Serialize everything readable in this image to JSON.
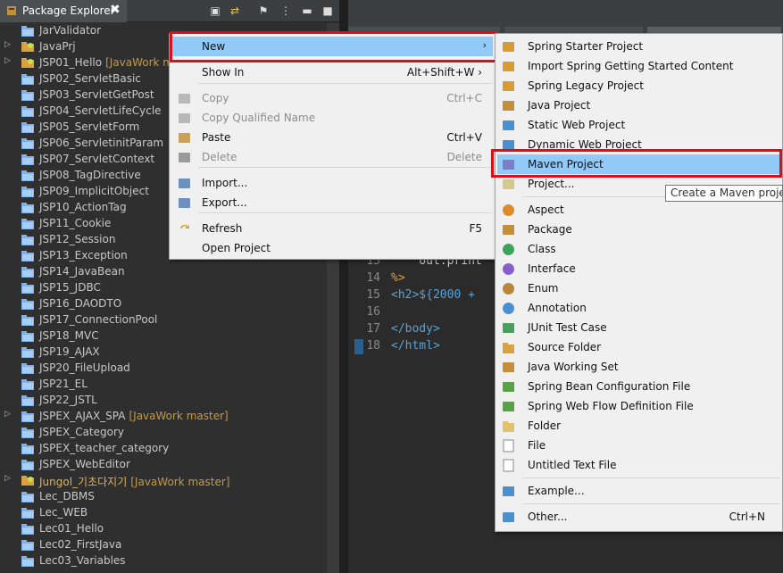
{
  "package_explorer": {
    "tab_label": "Package Explorer",
    "close_label": "✖",
    "items": [
      {
        "name": "JarValidator",
        "expandable": false,
        "branch": "",
        "special": false
      },
      {
        "name": "JavaPrj",
        "expandable": true,
        "branch": "",
        "special": false
      },
      {
        "name": "JSP01_Hello",
        "expandable": true,
        "branch": "[JavaWork master]",
        "special": false
      },
      {
        "name": "JSP02_ServletBasic",
        "expandable": false,
        "branch": "",
        "special": false
      },
      {
        "name": "JSP03_ServletGetPost",
        "expandable": false,
        "branch": "",
        "special": false
      },
      {
        "name": "JSP04_ServletLifeCycle",
        "expandable": false,
        "branch": "",
        "special": false
      },
      {
        "name": "JSP05_ServletForm",
        "expandable": false,
        "branch": "",
        "special": false
      },
      {
        "name": "JSP06_ServletinitParam",
        "expandable": false,
        "branch": "",
        "special": false
      },
      {
        "name": "JSP07_ServletContext",
        "expandable": false,
        "branch": "",
        "special": false
      },
      {
        "name": "JSP08_TagDirective",
        "expandable": false,
        "branch": "",
        "special": false
      },
      {
        "name": "JSP09_ImplicitObject",
        "expandable": false,
        "branch": "",
        "special": false
      },
      {
        "name": "JSP10_ActionTag",
        "expandable": false,
        "branch": "",
        "special": false
      },
      {
        "name": "JSP11_Cookie",
        "expandable": false,
        "branch": "",
        "special": false
      },
      {
        "name": "JSP12_Session",
        "expandable": false,
        "branch": "",
        "special": false
      },
      {
        "name": "JSP13_Exception",
        "expandable": false,
        "branch": "",
        "special": false
      },
      {
        "name": "JSP14_JavaBean",
        "expandable": false,
        "branch": "",
        "special": false
      },
      {
        "name": "JSP15_JDBC",
        "expandable": false,
        "branch": "",
        "special": false
      },
      {
        "name": "JSP16_DAODTO",
        "expandable": false,
        "branch": "",
        "special": false
      },
      {
        "name": "JSP17_ConnectionPool",
        "expandable": false,
        "branch": "",
        "special": false
      },
      {
        "name": "JSP18_MVC",
        "expandable": false,
        "branch": "",
        "special": false
      },
      {
        "name": "JSP19_AJAX",
        "expandable": false,
        "branch": "",
        "special": false
      },
      {
        "name": "JSP20_FileUpload",
        "expandable": false,
        "branch": "",
        "special": false
      },
      {
        "name": "JSP21_EL",
        "expandable": false,
        "branch": "",
        "special": false
      },
      {
        "name": "JSP22_JSTL",
        "expandable": false,
        "branch": "",
        "special": false
      },
      {
        "name": "JSPEX_AJAX_SPA",
        "expandable": true,
        "branch": "[JavaWork master]",
        "special": false
      },
      {
        "name": "JSPEX_Category",
        "expandable": false,
        "branch": "",
        "special": false
      },
      {
        "name": "JSPEX_teacher_category",
        "expandable": false,
        "branch": "",
        "special": false
      },
      {
        "name": "JSPEX_WebEditor",
        "expandable": false,
        "branch": "",
        "special": false
      },
      {
        "name": "Jungol_기초다지기",
        "expandable": true,
        "branch": "[JavaWork master]",
        "special": true
      },
      {
        "name": "Lec_DBMS",
        "expandable": false,
        "branch": "",
        "special": false
      },
      {
        "name": "Lec_WEB",
        "expandable": false,
        "branch": "",
        "special": false
      },
      {
        "name": "Lec01_Hello",
        "expandable": false,
        "branch": "",
        "special": false
      },
      {
        "name": "Lec02_FirstJava",
        "expandable": false,
        "branch": "",
        "special": false
      },
      {
        "name": "Lec03_Variables",
        "expandable": false,
        "branch": "",
        "special": false
      }
    ]
  },
  "editor": {
    "lines": [
      {
        "num": "15",
        "code": "    out.print"
      },
      {
        "num": "14",
        "code": "%>"
      },
      {
        "num": "15",
        "code": "<h2>${2000 +"
      },
      {
        "num": "16",
        "code": ""
      },
      {
        "num": "17",
        "code": "</body>"
      },
      {
        "num": "18",
        "code": "</html>"
      }
    ]
  },
  "context_menu": {
    "items": [
      {
        "label": "New",
        "shortcut": "",
        "disabled": false,
        "selected": true,
        "submenu": true,
        "icon": "none"
      },
      {
        "label": "Show In",
        "shortcut": "Alt+Shift+W ›",
        "disabled": false,
        "selected": false,
        "submenu": false,
        "icon": "none"
      },
      {
        "label": "Copy",
        "shortcut": "Ctrl+C",
        "disabled": true,
        "selected": false,
        "submenu": false,
        "icon": "copy-icon"
      },
      {
        "label": "Copy Qualified Name",
        "shortcut": "",
        "disabled": true,
        "selected": false,
        "submenu": false,
        "icon": "copy-icon"
      },
      {
        "label": "Paste",
        "shortcut": "Ctrl+V",
        "disabled": false,
        "selected": false,
        "submenu": false,
        "icon": "paste-icon"
      },
      {
        "label": "Delete",
        "shortcut": "Delete",
        "disabled": true,
        "selected": false,
        "submenu": false,
        "icon": "delete-icon"
      },
      {
        "label": "Import...",
        "shortcut": "",
        "disabled": false,
        "selected": false,
        "submenu": false,
        "icon": "import-icon"
      },
      {
        "label": "Export...",
        "shortcut": "",
        "disabled": false,
        "selected": false,
        "submenu": false,
        "icon": "export-icon"
      },
      {
        "label": "Refresh",
        "shortcut": "F5",
        "disabled": false,
        "selected": false,
        "submenu": false,
        "icon": "refresh-icon"
      },
      {
        "label": "Open Project",
        "shortcut": "",
        "disabled": false,
        "selected": false,
        "submenu": false,
        "icon": "none"
      }
    ]
  },
  "new_submenu": {
    "items": [
      {
        "label": "Spring Starter Project",
        "shortcut": "",
        "icon": "spring-project-icon",
        "selected": false
      },
      {
        "label": "Import Spring Getting Started Content",
        "shortcut": "",
        "icon": "spring-project-icon",
        "selected": false
      },
      {
        "label": "Spring Legacy Project",
        "shortcut": "",
        "icon": "spring-project-icon",
        "selected": false
      },
      {
        "label": "Java Project",
        "shortcut": "",
        "icon": "java-project-icon",
        "selected": false
      },
      {
        "label": "Static Web Project",
        "shortcut": "",
        "icon": "web-project-icon",
        "selected": false
      },
      {
        "label": "Dynamic Web Project",
        "shortcut": "",
        "icon": "web-project-icon",
        "selected": false
      },
      {
        "label": "Maven Project",
        "shortcut": "",
        "icon": "maven-project-icon",
        "selected": true
      },
      {
        "label": "Project...",
        "shortcut": "",
        "icon": "project-icon",
        "selected": false
      },
      {
        "label": "Aspect",
        "shortcut": "",
        "icon": "aspect-icon",
        "selected": false
      },
      {
        "label": "Package",
        "shortcut": "",
        "icon": "package-icon",
        "selected": false
      },
      {
        "label": "Class",
        "shortcut": "",
        "icon": "class-icon",
        "selected": false
      },
      {
        "label": "Interface",
        "shortcut": "",
        "icon": "interface-icon",
        "selected": false
      },
      {
        "label": "Enum",
        "shortcut": "",
        "icon": "enum-icon",
        "selected": false
      },
      {
        "label": "Annotation",
        "shortcut": "",
        "icon": "annotation-icon",
        "selected": false
      },
      {
        "label": "JUnit Test Case",
        "shortcut": "",
        "icon": "junit-icon",
        "selected": false
      },
      {
        "label": "Source Folder",
        "shortcut": "",
        "icon": "source-folder-icon",
        "selected": false
      },
      {
        "label": "Java Working Set",
        "shortcut": "",
        "icon": "working-set-icon",
        "selected": false
      },
      {
        "label": "Spring Bean Configuration File",
        "shortcut": "",
        "icon": "spring-file-icon",
        "selected": false
      },
      {
        "label": "Spring Web Flow Definition File",
        "shortcut": "",
        "icon": "spring-file-icon",
        "selected": false
      },
      {
        "label": "Folder",
        "shortcut": "",
        "icon": "folder-icon",
        "selected": false
      },
      {
        "label": "File",
        "shortcut": "",
        "icon": "file-icon",
        "selected": false
      },
      {
        "label": "Untitled Text File",
        "shortcut": "",
        "icon": "text-file-icon",
        "selected": false
      },
      {
        "label": "Example...",
        "shortcut": "",
        "icon": "example-icon",
        "selected": false
      },
      {
        "label": "Other...",
        "shortcut": "Ctrl+N",
        "icon": "other-icon",
        "selected": false
      }
    ]
  },
  "tooltip": {
    "text": "Create a Maven project"
  },
  "colors": {
    "selection": "#91c9f7",
    "highlight_box": "#d6111d",
    "menu_bg": "#f0f0f0",
    "explorer_bg": "#2f2f2f",
    "branch_text": "#c39a4b"
  }
}
